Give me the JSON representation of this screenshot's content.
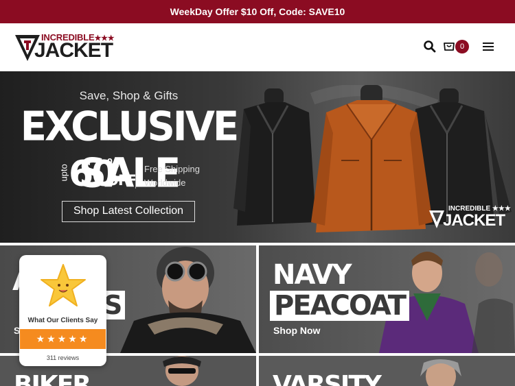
{
  "topbar": {
    "offer_text": "WeekDay Offer $10 Off, Code: SAVE10"
  },
  "header": {
    "logo_top": "INCREDIBLE",
    "logo_stars": "★★★",
    "logo_main": "JACKET",
    "cart_count": "0",
    "icons": [
      "search-icon",
      "cart-icon",
      "menu-icon"
    ]
  },
  "hero": {
    "subtitle": "Save, Shop & Gifts",
    "title": "EXCLUSIVE SALE",
    "upto": "upto",
    "discount": "60",
    "percent": "%",
    "off": "OFF",
    "shipping_line1": "Free Shipping",
    "shipping_line2": "Worldwide",
    "cta": "Shop Latest Collection",
    "watermark_top": "INCREDIBLE ★★★",
    "watermark_main": "JACKET"
  },
  "tiles": {
    "aviator": {
      "title": "A",
      "boxed": "S",
      "cta": "S"
    },
    "navy": {
      "title": "NAVY",
      "boxed": "PEACOAT",
      "cta": "Shop Now"
    },
    "biker": {
      "title": "BIKER"
    },
    "varsity": {
      "title": "VARSITY"
    }
  },
  "reviews": {
    "title": "What Our Clients Say",
    "stars": "★★★★★",
    "count": "311 reviews"
  },
  "colors": {
    "brand": "#8b0c22",
    "review_bar": "#f58b1f"
  }
}
